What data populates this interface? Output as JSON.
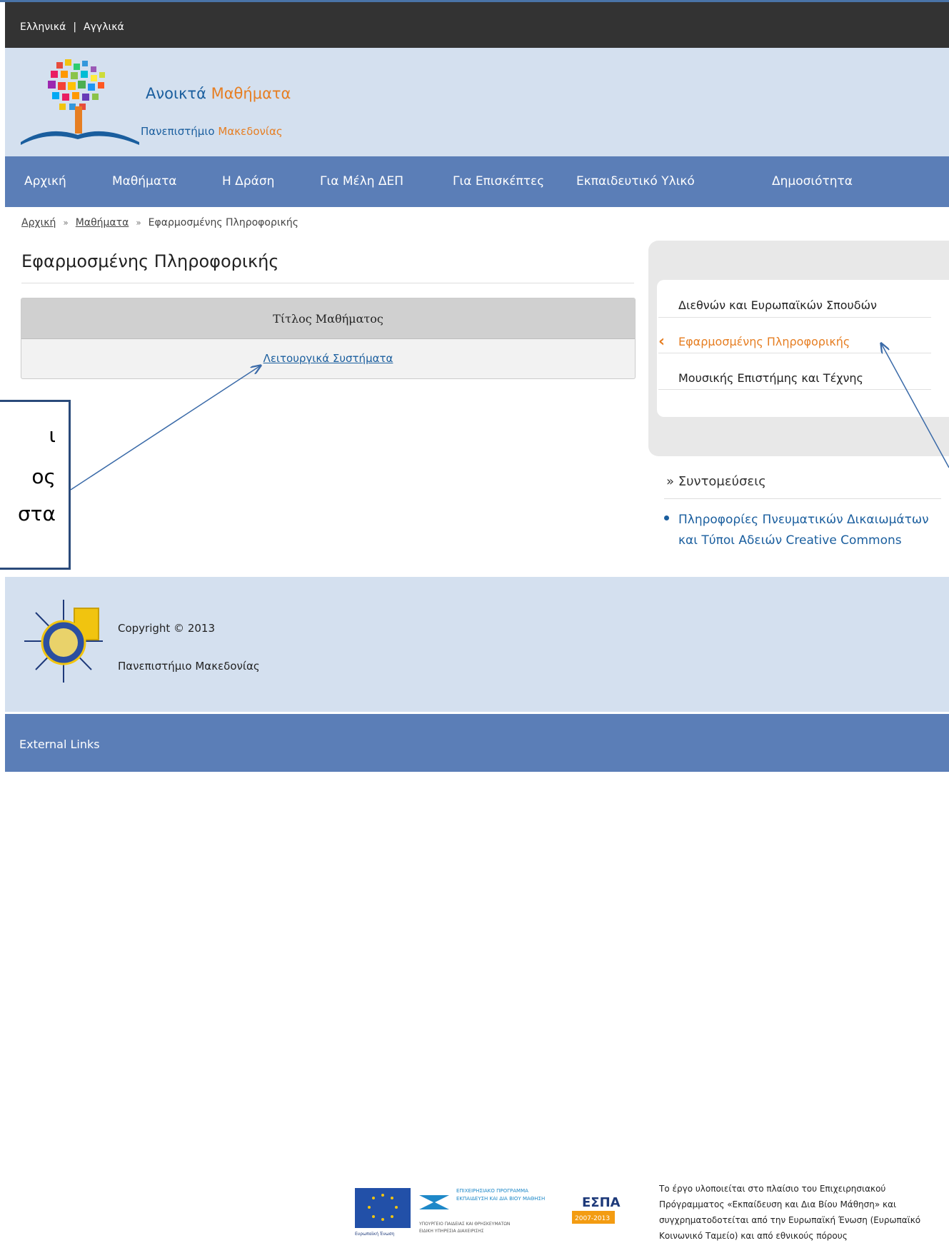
{
  "topbar": {
    "lang_greek": "Ελληνικά",
    "separator": "|",
    "lang_english": "Αγγλικά"
  },
  "header": {
    "title_part1": "Ανοικτά ",
    "title_part2": "Μαθήματα",
    "subtitle_part1": "Πανεπιστήμιο ",
    "subtitle_part2": "Μακεδονίας"
  },
  "nav": {
    "items": [
      "Αρχική",
      "Μαθήματα",
      "Η Δράση",
      "Για Μέλη ΔΕΠ",
      "Για Επισκέπτες",
      "Εκπαιδευτικό Υλικό",
      "Δημοσιότητα"
    ]
  },
  "breadcrumb": {
    "home": "Αρχική",
    "courses": "Μαθήματα",
    "current": "Εφαρμοσμένης Πληροφορικής",
    "sep": "»"
  },
  "main": {
    "page_title": "Εφαρμοσμένης Πληροφορικής",
    "table": {
      "header": "Τίτλος Μαθήματος",
      "rows": [
        "Λειτουργικά Συστήματα"
      ]
    }
  },
  "callout": {
    "lines": [
      "ι",
      "ος",
      "στα"
    ]
  },
  "sidebar": {
    "departments": [
      "Διεθνών και Ευρωπαϊκών Σπουδών",
      "Εφαρμοσμένης Πληροφορικής",
      "Μουσικής Επιστήμης και Τέχνης"
    ],
    "active_index": 1,
    "shortcuts_title": "» Συντομεύσεις",
    "shortcut_link": "Πληροφορίες Πνευματικών Δικαιωμάτων και Τύποι Αδειών Creative Commons"
  },
  "footer": {
    "copyright": "Copyright © 2013",
    "university": "Πανεπιστήμιο Μακεδονίας",
    "espa": {
      "program_line1": "ΕΠΙΧΕΙΡΗΣΙΑΚΟ ΠΡΟΓΡΑΜΜΑ",
      "program_line2": "ΕΚΠΑΙΔΕΥΣΗ ΚΑΙ ΔΙΑ ΒΙΟΥ ΜΑΘΗΣΗ",
      "ministry": "ΥΠΟΥΡΓΕΙΟ ΠΑΙΔΕΙΑΣ ΚΑΙ ΘΡΗΣΚΕΥΜΑΤΩΝ",
      "authority": "ΕΙΔΙΚΗ ΥΠΗΡΕΣΙΑ ΔΙΑΧΕΙΡΙΣΗΣ",
      "eu": "Ευρωπαϊκή Ένωση",
      "espa": "ΕΣΠΑ",
      "years": "2007-2013"
    },
    "funding_text": "Το έργο υλοποιείται στο πλαίσιο του Επιχειρησιακού Πρόγραμματος «Εκπαίδευση και Δια Βίου Μάθηση» και συγχρηματοδοτείται από την Ευρωπαϊκή Ένωση (Ευρωπαϊκό Κοινωνικό Ταμείο) και από εθνικούς πόρους",
    "external_links": "External Links"
  },
  "colors": {
    "nav": "#5b7eb7",
    "header": "#d4e0ef",
    "accent": "#e67e22",
    "link": "#1a5e9e",
    "annotation": "#3a6aa8"
  }
}
